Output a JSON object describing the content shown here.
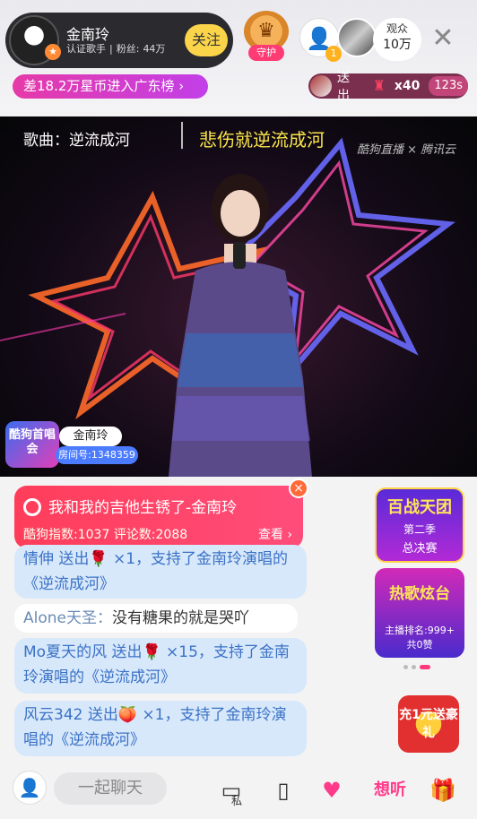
{
  "host": {
    "name": "金南玲",
    "title": "认证歌手",
    "fans_label": "粉丝:",
    "fans": "44万",
    "follow_label": "关注"
  },
  "guard": {
    "label": "守护"
  },
  "viewers": {
    "rank_badge": "1",
    "audience_label": "观众",
    "audience_count": "10万"
  },
  "rank_banner": {
    "text": "差18.2万星币进入广东榜"
  },
  "gift_notice": {
    "action": "送出",
    "count": "x40",
    "time": "123s"
  },
  "video": {
    "song_prefix": "歌曲：",
    "song": "逆流成河",
    "lyric": "悲伤就逆流成河",
    "watermark": "酷狗直播 × 腾讯云",
    "logo": "酷狗首唱会",
    "singer_tag": "金南玲",
    "room": "房间号:1348359"
  },
  "song_card": {
    "title": "我和我的吉他生锈了-金南玲",
    "stats": "酷狗指数:1037  评论数:2088",
    "view": "查看"
  },
  "chat": [
    {
      "text": "情伸 送出🌹 ×1，支持了金南玲演唱的《逆流成河》"
    },
    {
      "user": "Alone天圣：",
      "text": "没有糖果的就是哭吖"
    },
    {
      "text": "Mo夏天的风 送出🌹 ×15，支持了金南玲演唱的《逆流成河》"
    },
    {
      "text": "风云342 送出🍑 ×1，支持了金南玲演唱的《逆流成河》"
    }
  ],
  "promo": {
    "battle_title": "百战天团",
    "battle_season": "第二季",
    "battle_round": "总决赛",
    "hot_title": "热歌炫台",
    "hot_rank": "主播排名:999+",
    "hot_likes": "共0赞",
    "recharge": "充1元送豪礼"
  },
  "bottom": {
    "chat_placeholder": "一起聊天",
    "private_label": "私",
    "want_label": "想听"
  }
}
